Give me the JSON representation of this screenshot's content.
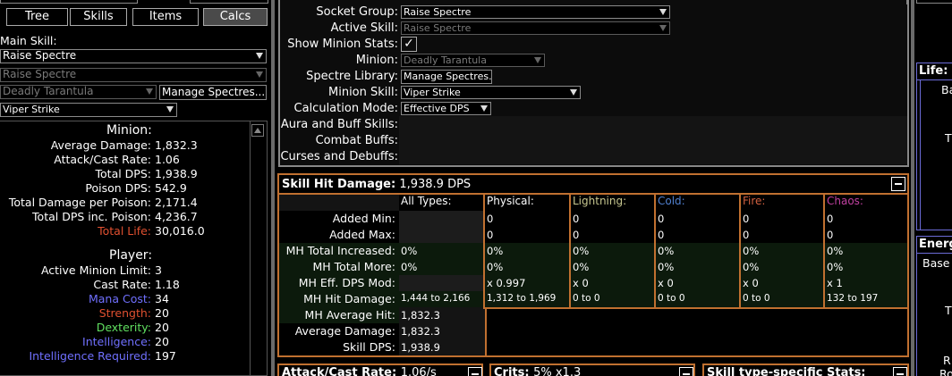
{
  "tabs": [
    {
      "label": "Tree",
      "active": false
    },
    {
      "label": "Skills",
      "active": false
    },
    {
      "label": "Items",
      "active": false
    },
    {
      "label": "Calcs",
      "active": true
    }
  ],
  "left": {
    "main_skill_label": "Main Skill:",
    "main_skill": "Raise Spectre",
    "active_skill": "Raise Spectre",
    "minion": "Deadly Tarantula",
    "manage_spectres": "Manage Spectres...",
    "minion_skill": "Viper Strike",
    "minion_header": "Minion:",
    "minion_stats": [
      {
        "label": "Average Damage:",
        "value": "1,832.3",
        "color": "#ffffff"
      },
      {
        "label": "Attack/Cast Rate:",
        "value": "1.06",
        "color": "#ffffff"
      },
      {
        "label": "Total DPS:",
        "value": "1,938.9",
        "color": "#ffffff"
      },
      {
        "label": "Poison DPS:",
        "value": "542.9",
        "color": "#ffffff"
      },
      {
        "label": "Total Damage per Poison:",
        "value": "2,171.4",
        "color": "#ffffff"
      },
      {
        "label": "Total DPS inc. Poison:",
        "value": "4,236.7",
        "color": "#ffffff"
      },
      {
        "label": "Total Life:",
        "value": "30,016.0",
        "color": "#e05030"
      }
    ],
    "player_header": "Player:",
    "player_stats": [
      {
        "label": "Active Minion Limit:",
        "value": "3",
        "color": "#ffffff"
      },
      {
        "label": "Cast Rate:",
        "value": "1.18",
        "color": "#ffffff"
      },
      {
        "label": "Mana Cost:",
        "value": "34",
        "color": "#7070ff"
      },
      {
        "label": "Strength:",
        "value": "20",
        "color": "#e05030"
      },
      {
        "label": "Dexterity:",
        "value": "20",
        "color": "#60e060"
      },
      {
        "label": "Intelligence:",
        "value": "20",
        "color": "#7070ff"
      },
      {
        "label": "Intelligence Required:",
        "value": "197",
        "color": "#7070ff"
      }
    ]
  },
  "config": {
    "rows": [
      {
        "label": "Socket Group:",
        "value": "Raise Spectre"
      },
      {
        "label": "Active Skill:",
        "value": "Raise Spectre"
      },
      {
        "label": "Show Minion Stats:",
        "value": "✓"
      },
      {
        "label": "Minion:",
        "value": "Deadly Tarantula"
      },
      {
        "label": "Spectre Library:",
        "value": "Manage Spectres..."
      },
      {
        "label": "Minion Skill:",
        "value": "Viper Strike"
      },
      {
        "label": "Calculation Mode:",
        "value": "Effective DPS"
      },
      {
        "label": "Aura and Buff Skills:",
        "value": ""
      },
      {
        "label": "Combat Buffs:",
        "value": ""
      },
      {
        "label": "Curses and Debuffs:",
        "value": ""
      }
    ]
  },
  "hit_damage": {
    "title": "Skill Hit Damage:",
    "title_value": "1,938.9 DPS",
    "columns": [
      {
        "name": "All Types:",
        "color": "#ffffff"
      },
      {
        "name": "Physical:",
        "color": "#ffffff"
      },
      {
        "name": "Lightning:",
        "color": "#c8c890"
      },
      {
        "name": "Cold:",
        "color": "#5080d0"
      },
      {
        "name": "Fire:",
        "color": "#d06040"
      },
      {
        "name": "Chaos:",
        "color": "#c040a0"
      }
    ],
    "rows": [
      {
        "label": "Added Min:",
        "cells": [
          "",
          "0",
          "0",
          "0",
          "0",
          "0"
        ]
      },
      {
        "label": "Added Max:",
        "cells": [
          "",
          "0",
          "0",
          "0",
          "0",
          "0"
        ]
      },
      {
        "label": "MH Total Increased:",
        "cells": [
          "0%",
          "0%",
          "0%",
          "0%",
          "0%",
          "0%"
        ]
      },
      {
        "label": "MH Total More:",
        "cells": [
          "0%",
          "0%",
          "0%",
          "0%",
          "0%",
          "0%"
        ]
      },
      {
        "label": "MH Eff. DPS Mod:",
        "cells": [
          "",
          "x 0.997",
          "x 0",
          "x 0",
          "x 0",
          "x 1"
        ]
      },
      {
        "label": "MH Hit Damage:",
        "cells": [
          "1,444 to 2,166",
          "1,312 to 1,969",
          "0 to 0",
          "0 to 0",
          "0 to 0",
          "132 to 197"
        ]
      },
      {
        "label": "MH Average Hit:",
        "cells": [
          "1,832.3"
        ]
      },
      {
        "label": "Average Damage:",
        "cells": [
          "1,832.3"
        ]
      },
      {
        "label": "Skill DPS:",
        "cells": [
          "1,938.9"
        ]
      }
    ]
  },
  "bottom": {
    "attack_rate_title": "Attack/Cast Rate:",
    "attack_rate_value": "1.06/s",
    "crits_title": "Crits:",
    "crits_value": "5% x1.3",
    "skill_type_title": "Skill type-specific Stats:"
  },
  "right": {
    "life_title": "Life:",
    "life_partial": "Ba",
    "life_partial2": "T",
    "energy_title": "Energ",
    "energy_partial": "Base",
    "energy_partial2": "T",
    "energy_partial3": "R",
    "energy_partial4": "Ro"
  }
}
